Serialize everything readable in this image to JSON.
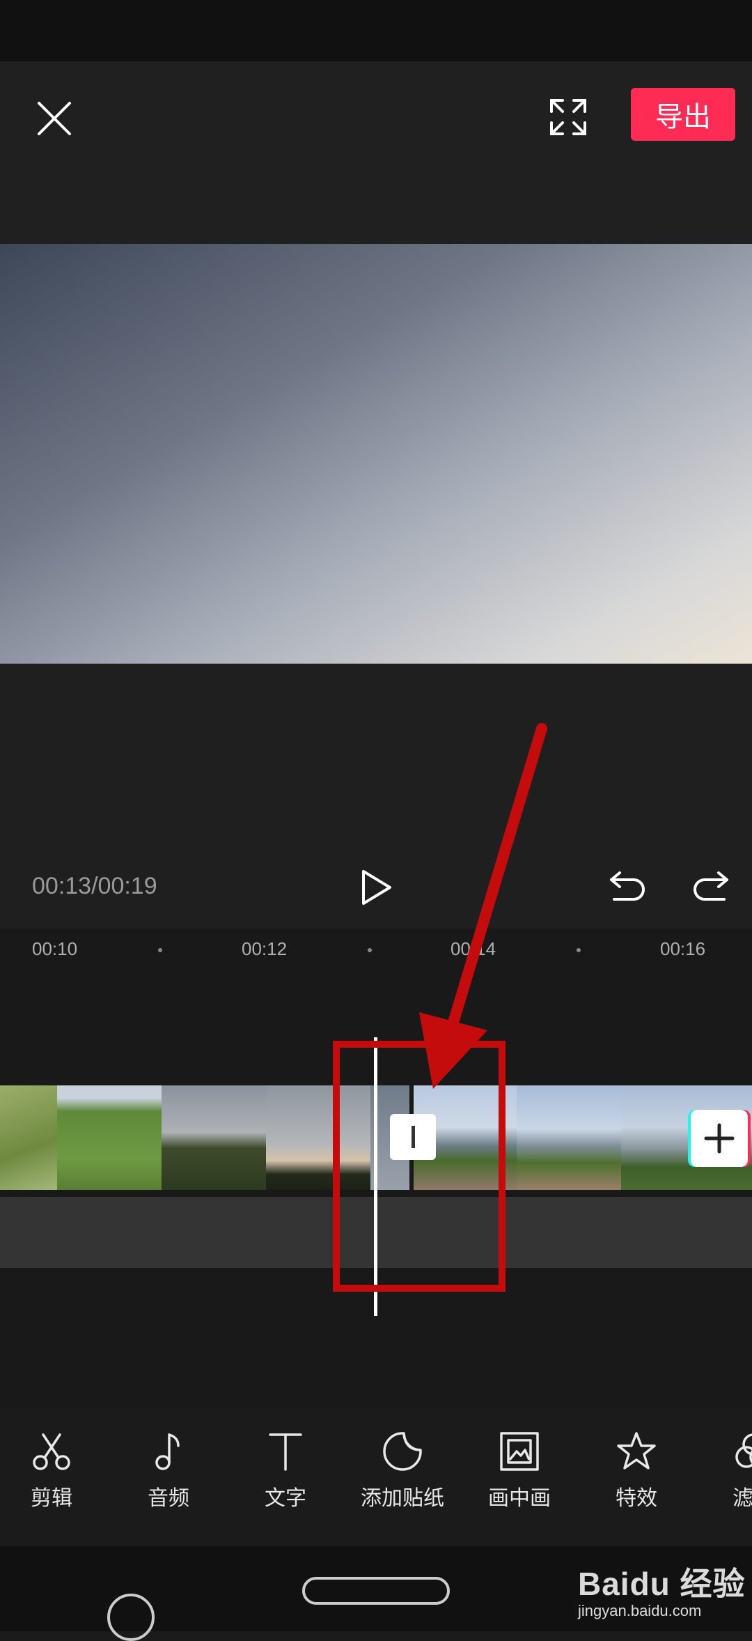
{
  "header": {
    "export_label": "导出",
    "close_icon": "close-icon",
    "fullscreen_icon": "fullscreen-icon"
  },
  "player": {
    "time": "00:13/00:19",
    "play_icon": "play-icon",
    "undo_icon": "undo-icon",
    "redo_icon": "redo-icon"
  },
  "ruler": {
    "ticks": [
      "00:10",
      "00:12",
      "00:14",
      "00:16"
    ]
  },
  "toolbar": {
    "items": [
      {
        "label": "剪辑",
        "icon": "scissors-icon"
      },
      {
        "label": "音频",
        "icon": "music-note-icon"
      },
      {
        "label": "文字",
        "icon": "text-icon"
      },
      {
        "label": "添加贴纸",
        "icon": "sticker-icon"
      },
      {
        "label": "画中画",
        "icon": "picture-in-picture-icon"
      },
      {
        "label": "特效",
        "icon": "star-effect-icon"
      },
      {
        "label": "滤",
        "icon": "filter-icon"
      }
    ]
  },
  "watermark": {
    "main": "Baidu 经验",
    "sub": "jingyan.baidu.com"
  },
  "colors": {
    "accent": "#fe2c55",
    "highlight": "#c40c0c",
    "background": "#1b1b1b"
  }
}
